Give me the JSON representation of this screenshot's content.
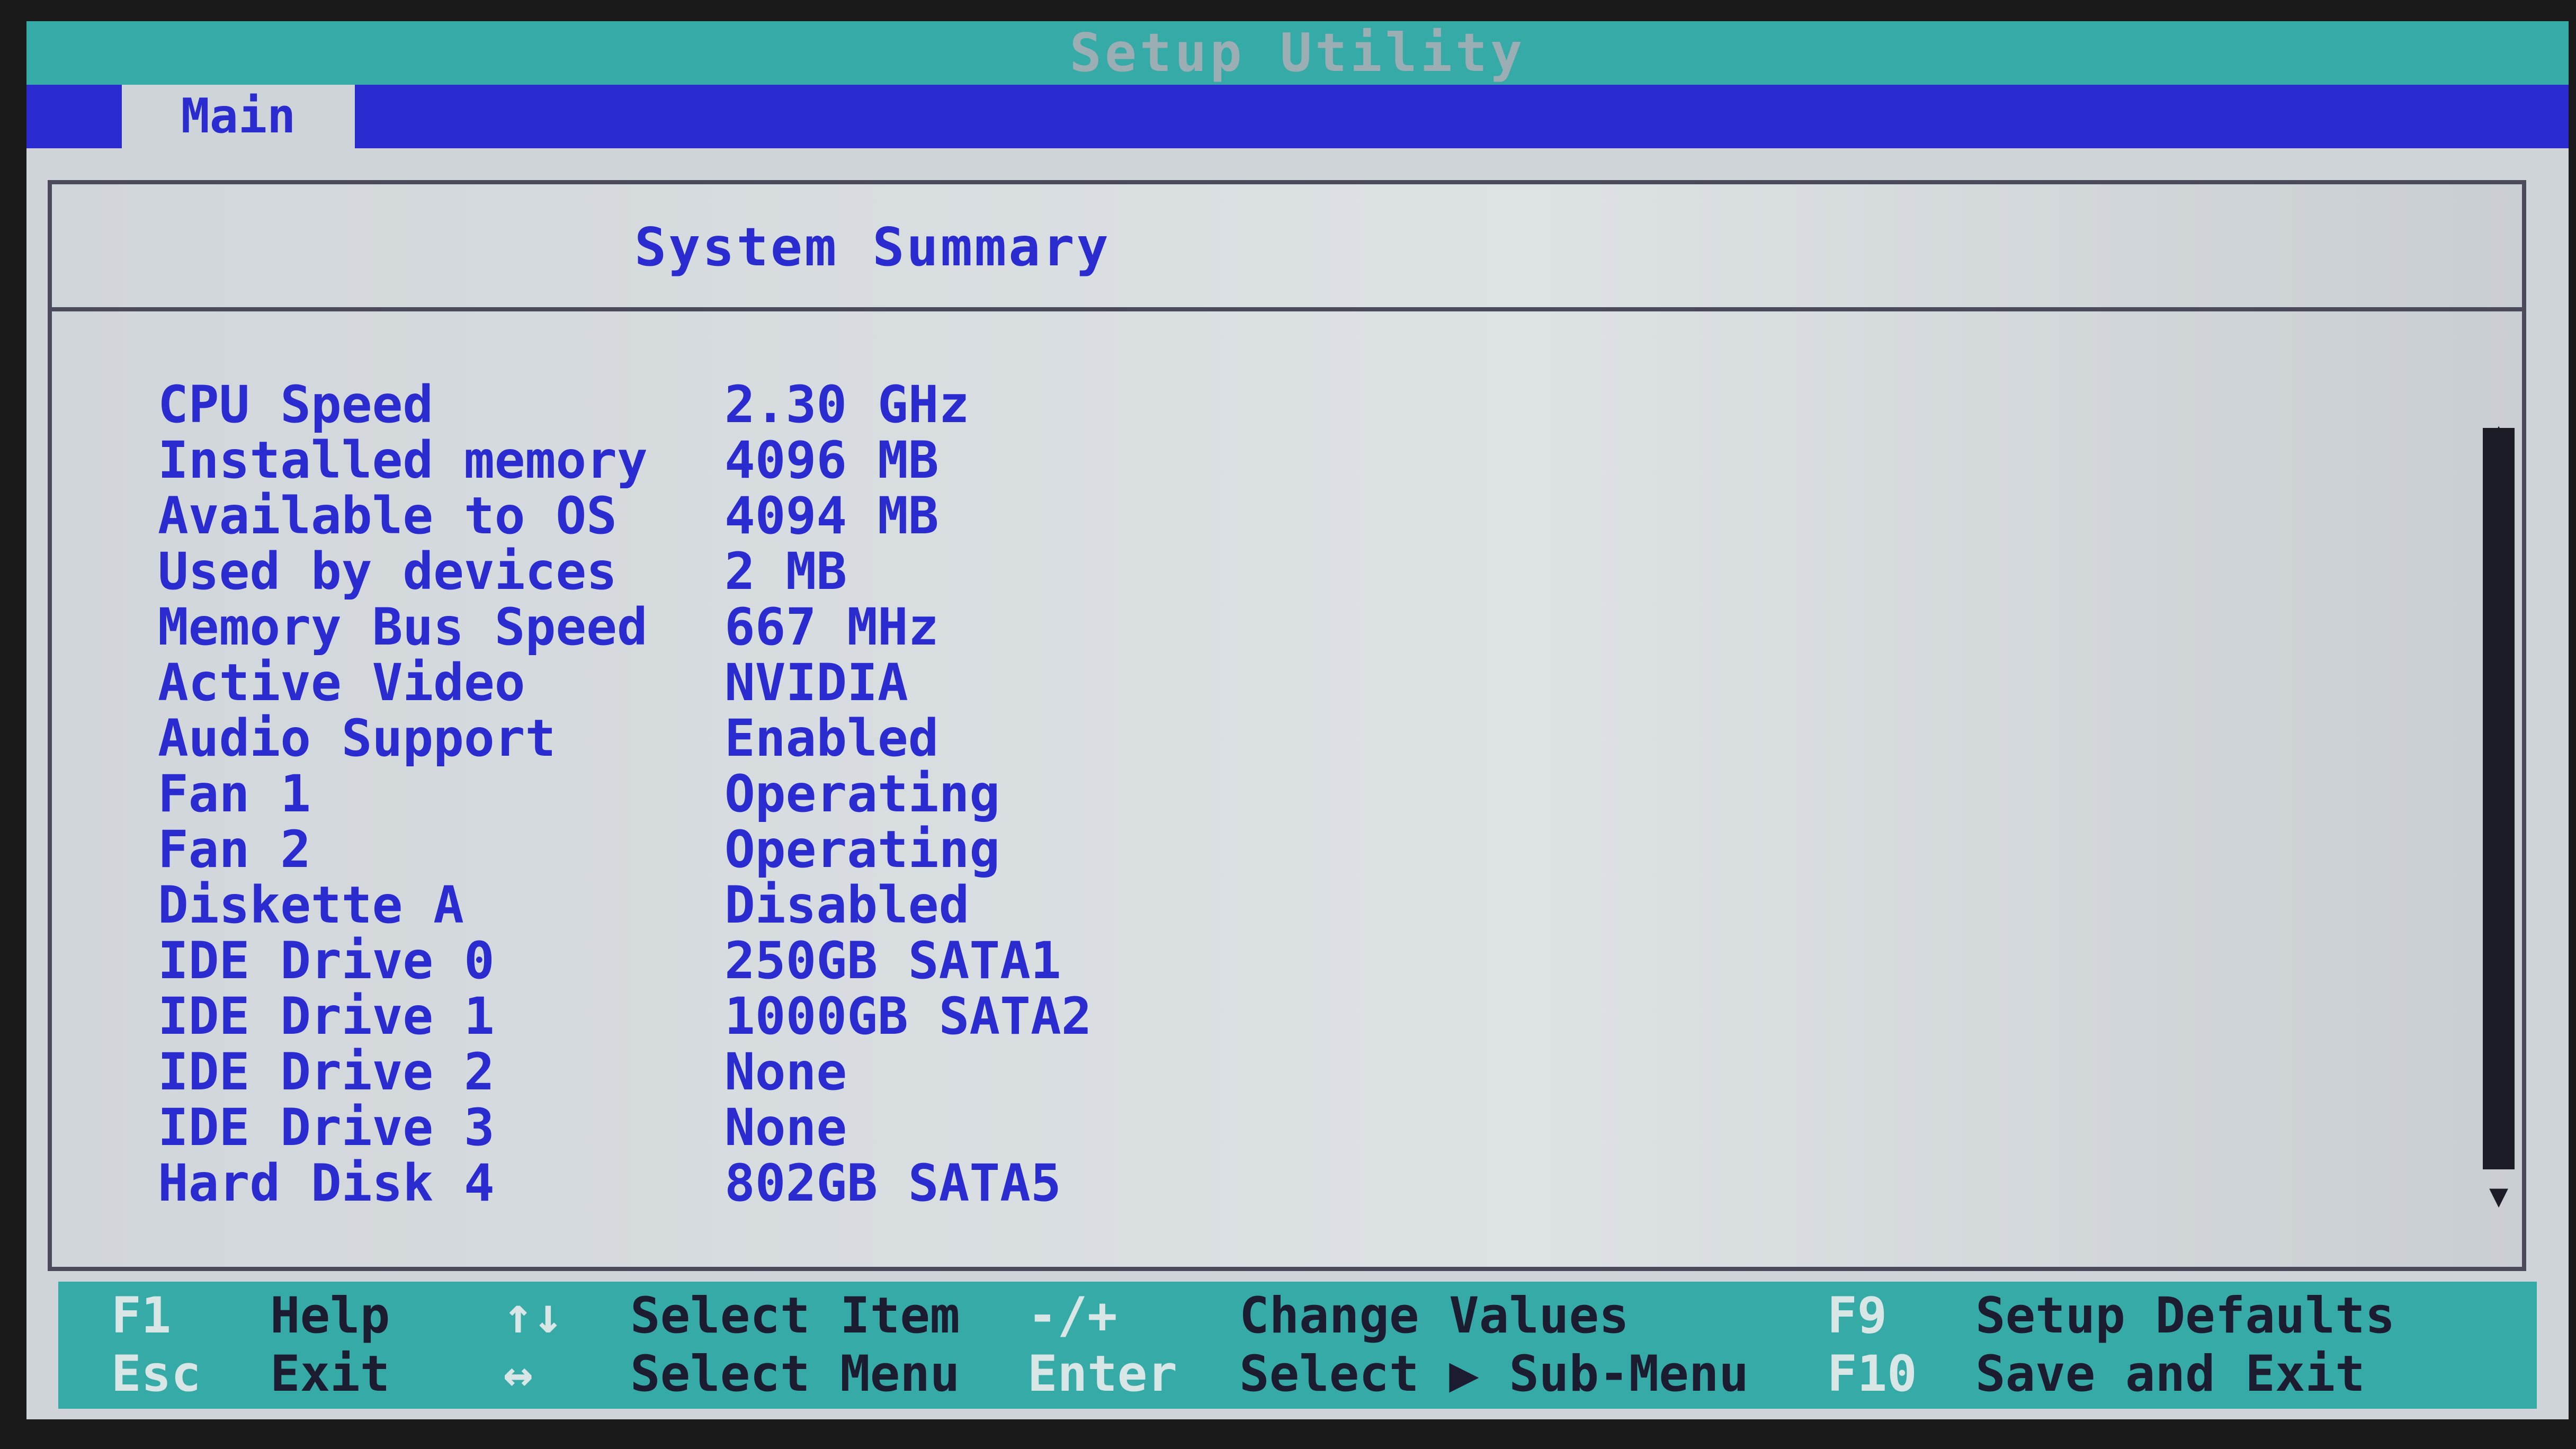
{
  "window": {
    "title": "Setup Utility"
  },
  "tabs": [
    {
      "label": "Main"
    }
  ],
  "panel": {
    "title": "System Summary"
  },
  "summary": [
    {
      "label": "CPU Speed",
      "value": "2.30 GHz"
    },
    {
      "label": "Installed memory",
      "value": "4096 MB"
    },
    {
      "label": "Available to OS",
      "value": "4094 MB"
    },
    {
      "label": "Used by devices",
      "value": "2 MB"
    },
    {
      "label": "Memory Bus Speed",
      "value": "667 MHz"
    },
    {
      "label": "Active Video",
      "value": "NVIDIA"
    },
    {
      "label": "Audio Support",
      "value": "Enabled"
    },
    {
      "label": "Fan 1",
      "value": "Operating"
    },
    {
      "label": "Fan 2",
      "value": "Operating"
    },
    {
      "label": "Diskette A",
      "value": "Disabled"
    },
    {
      "label": "IDE Drive 0",
      "value": "250GB SATA1"
    },
    {
      "label": "IDE Drive 1",
      "value": "1000GB SATA2"
    },
    {
      "label": "IDE Drive 2",
      "value": "None"
    },
    {
      "label": "IDE Drive 3",
      "value": "None"
    },
    {
      "label": "Hard Disk 4",
      "value": "802GB SATA5"
    }
  ],
  "footer": {
    "f1_key": "F1",
    "f1_desc": "Help",
    "esc_key": "Esc",
    "esc_desc": "Exit",
    "updown_key": "↑↓",
    "updown_desc": "Select Item",
    "leftright_key": "↔",
    "leftright_desc": "Select Menu",
    "plusminus_key": "-/+",
    "plusminus_desc": "Change Values",
    "enter_key": "Enter",
    "enter_desc": "Select ▶ Sub-Menu",
    "f9_key": "F9",
    "f9_desc": "Setup Defaults",
    "f10_key": "F10",
    "f10_desc": "Save and Exit"
  },
  "colors": {
    "accent": "#2a2ccf",
    "teal": "#36aaa7",
    "panel": "#cfd4d8"
  }
}
